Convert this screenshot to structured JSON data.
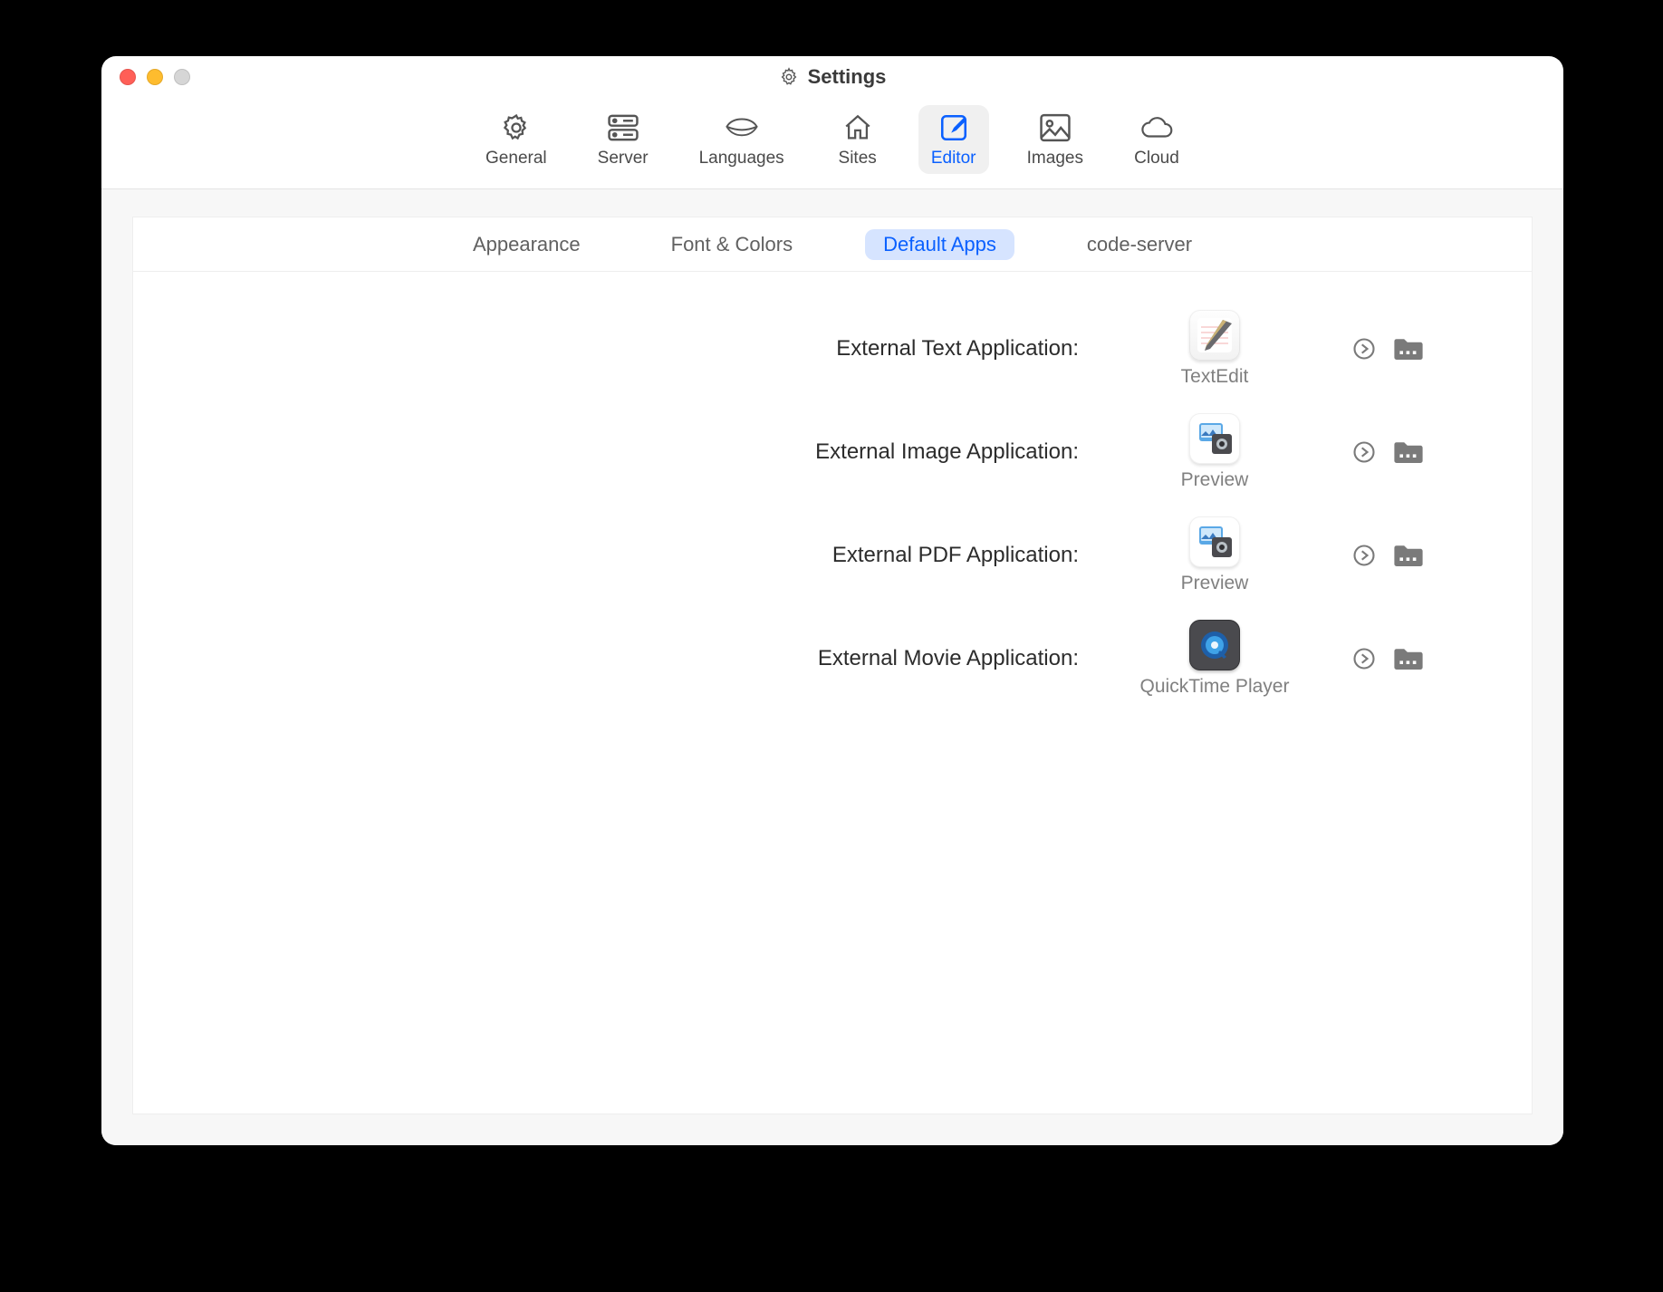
{
  "window": {
    "title": "Settings"
  },
  "toolbar": [
    {
      "id": "general",
      "label": "General"
    },
    {
      "id": "server",
      "label": "Server"
    },
    {
      "id": "languages",
      "label": "Languages"
    },
    {
      "id": "sites",
      "label": "Sites"
    },
    {
      "id": "editor",
      "label": "Editor",
      "active": true
    },
    {
      "id": "images",
      "label": "Images"
    },
    {
      "id": "cloud",
      "label": "Cloud"
    }
  ],
  "subtabs": [
    {
      "id": "appearance",
      "label": "Appearance"
    },
    {
      "id": "font-colors",
      "label": "Font & Colors"
    },
    {
      "id": "default-apps",
      "label": "Default Apps",
      "selected": true
    },
    {
      "id": "code-server",
      "label": "code-server"
    }
  ],
  "rows": [
    {
      "label": "External Text Application:",
      "app": "TextEdit",
      "icon": "textedit"
    },
    {
      "label": "External Image Application:",
      "app": "Preview",
      "icon": "preview"
    },
    {
      "label": "External PDF Application:",
      "app": "Preview",
      "icon": "preview"
    },
    {
      "label": "External Movie Application:",
      "app": "QuickTime Player",
      "icon": "quicktime"
    }
  ]
}
